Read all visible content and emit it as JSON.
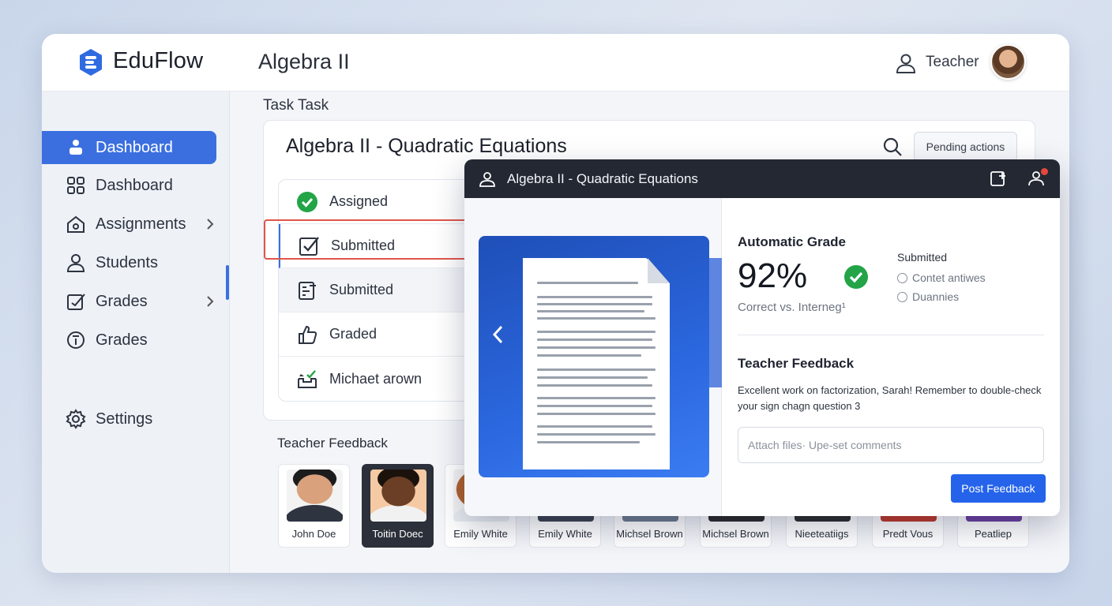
{
  "brand": {
    "name": "EduFlow"
  },
  "header": {
    "course": "Algebra II",
    "user_role": "Teacher"
  },
  "sidebar": {
    "items": [
      {
        "label": "Dashboard",
        "icon": "dashboard-icon",
        "active": true
      },
      {
        "label": "Dashboard",
        "icon": "grid-icon"
      },
      {
        "label": "Assignments",
        "icon": "assignments-icon",
        "has_submenu": true
      },
      {
        "label": "Students",
        "icon": "person-icon"
      },
      {
        "label": "Grades",
        "icon": "grades-icon",
        "has_submenu": true
      },
      {
        "label": "Grades",
        "icon": "info-icon"
      },
      {
        "label": "Settings",
        "icon": "gear-icon"
      }
    ]
  },
  "main": {
    "section_label": "Task Task",
    "title": "Algebra II - Quadratic Equations",
    "pending_button": "Pending actions",
    "statuses": [
      {
        "label": "Assigned",
        "icon": "check-circle-icon"
      },
      {
        "label": "Submitted",
        "icon": "checkbox-icon"
      },
      {
        "label": "Submitted",
        "icon": "document-list-icon"
      },
      {
        "label": "Graded",
        "icon": "thumbs-up-icon"
      },
      {
        "label": "Michaet arown",
        "icon": "inbox-check-icon"
      }
    ],
    "feedback_label": "Teacher Feedback",
    "students": [
      {
        "name": "John Doe"
      },
      {
        "name": "Toitin Doec",
        "selected": true
      },
      {
        "name": "Emily White"
      },
      {
        "name": "Emily White"
      },
      {
        "name": "Michsel Brown"
      },
      {
        "name": "Michsel Brown"
      },
      {
        "name": "Nieeteatiigs"
      },
      {
        "name": "Predt Vous"
      },
      {
        "name": "Peatliep"
      }
    ]
  },
  "modal": {
    "title": "Algebra II - Quadratic Equations",
    "auto_grade_label": "Automatic Grade",
    "grade": "92%",
    "grade_sub": "Correct vs. Interneg¹",
    "submitted_title": "Submitted",
    "submitted_options": [
      "Contet antiwes",
      "Duannies"
    ],
    "teacher_feedback_label": "Teacher Feedback",
    "feedback_text": "Excellent work on factorization, Sarah! Remember to double-check your sign chagn question 3",
    "attach_placeholder": "Attach files· Upe-set comments",
    "post_button": "Post Feedback"
  },
  "colors": {
    "accent": "#3b6fe0",
    "header_dark": "#232833",
    "success": "#22a447",
    "alert": "#e0554a"
  }
}
